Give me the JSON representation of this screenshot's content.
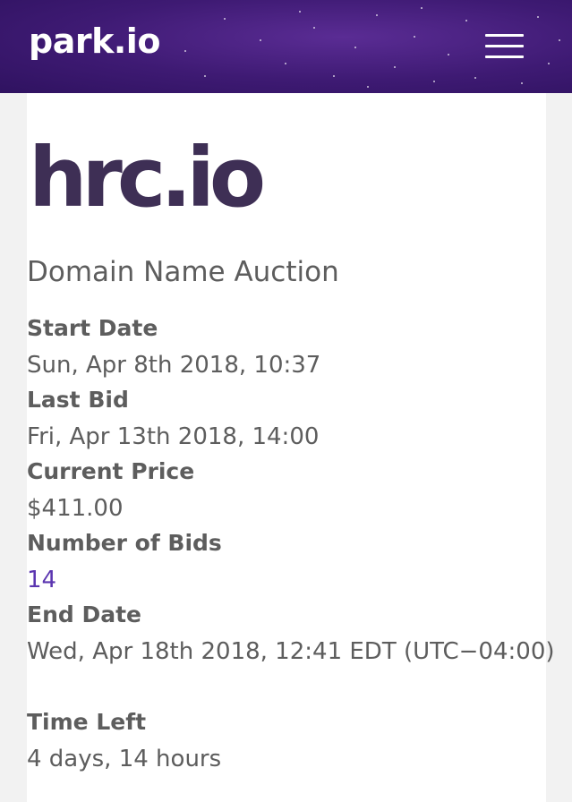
{
  "header": {
    "logo": "park.io",
    "menu_icon": "hamburger-menu-icon",
    "background_color": "#3e1a73"
  },
  "auction": {
    "domain": "hrc.io",
    "subtitle": "Domain Name Auction",
    "start_date_label": "Start Date",
    "start_date": "Sun, Apr 8th 2018, 10:37",
    "last_bid_label": "Last Bid",
    "last_bid": "Fri, Apr 13th 2018, 14:00",
    "current_price_label": "Current Price",
    "current_price": "$411.00",
    "bids_label": "Number of Bids",
    "bids": "14",
    "end_date_label": "End Date",
    "end_date": "Wed, Apr 18th 2018, 12:41 EDT (UTC−04:00)",
    "time_left_label": "Time Left",
    "time_left": "4 days, 14 hours"
  },
  "colors": {
    "title": "#3e2f55",
    "text": "#5d5d5d",
    "link": "#5b35b0"
  }
}
